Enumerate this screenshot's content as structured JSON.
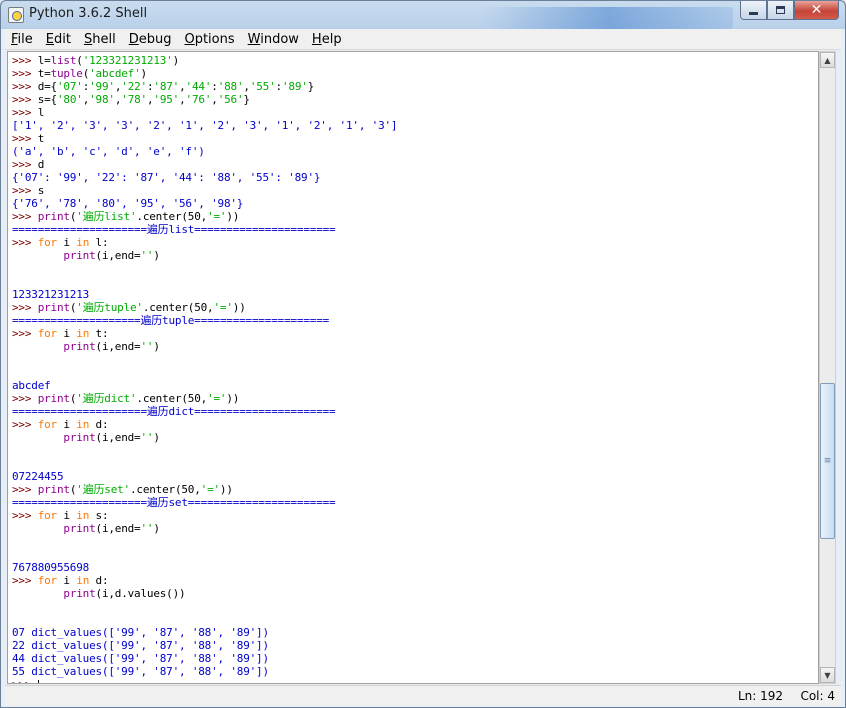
{
  "window": {
    "title": "Python 3.6.2 Shell",
    "controls": {
      "minimize": "minimize",
      "maximize": "maximize",
      "close": "✕"
    }
  },
  "menubar": {
    "items": [
      "File",
      "Edit",
      "Shell",
      "Debug",
      "Options",
      "Window",
      "Help"
    ]
  },
  "colors": {
    "prompt": "#770000",
    "keyword": "#ff7700",
    "builtin": "#900090",
    "string": "#00aa00",
    "stdout": "#0000cc"
  },
  "shell": {
    "lines": [
      [
        [
          "p",
          ">>> "
        ],
        [
          "c",
          "l="
        ],
        [
          "b",
          "list"
        ],
        [
          "c",
          "("
        ],
        [
          "s",
          "'123321231213'"
        ],
        [
          "c",
          ")"
        ]
      ],
      [
        [
          "p",
          ">>> "
        ],
        [
          "c",
          "t="
        ],
        [
          "b",
          "tuple"
        ],
        [
          "c",
          "("
        ],
        [
          "s",
          "'abcdef'"
        ],
        [
          "c",
          ")"
        ]
      ],
      [
        [
          "p",
          ">>> "
        ],
        [
          "c",
          "d={"
        ],
        [
          "s",
          "'07'"
        ],
        [
          "c",
          ":"
        ],
        [
          "s",
          "'99'"
        ],
        [
          "c",
          ","
        ],
        [
          "s",
          "'22'"
        ],
        [
          "c",
          ":"
        ],
        [
          "s",
          "'87'"
        ],
        [
          "c",
          ","
        ],
        [
          "s",
          "'44'"
        ],
        [
          "c",
          ":"
        ],
        [
          "s",
          "'88'"
        ],
        [
          "c",
          ","
        ],
        [
          "s",
          "'55'"
        ],
        [
          "c",
          ":"
        ],
        [
          "s",
          "'89'"
        ],
        [
          "c",
          "}"
        ]
      ],
      [
        [
          "p",
          ">>> "
        ],
        [
          "c",
          "s={"
        ],
        [
          "s",
          "'80'"
        ],
        [
          "c",
          ","
        ],
        [
          "s",
          "'98'"
        ],
        [
          "c",
          ","
        ],
        [
          "s",
          "'78'"
        ],
        [
          "c",
          ","
        ],
        [
          "s",
          "'95'"
        ],
        [
          "c",
          ","
        ],
        [
          "s",
          "'76'"
        ],
        [
          "c",
          ","
        ],
        [
          "s",
          "'56'"
        ],
        [
          "c",
          "}"
        ]
      ],
      [
        [
          "p",
          ">>> "
        ],
        [
          "c",
          "l"
        ]
      ],
      [
        [
          "o",
          "['1', '2', '3', '3', '2', '1', '2', '3', '1', '2', '1', '3']"
        ]
      ],
      [
        [
          "p",
          ">>> "
        ],
        [
          "c",
          "t"
        ]
      ],
      [
        [
          "o",
          "('a', 'b', 'c', 'd', 'e', 'f')"
        ]
      ],
      [
        [
          "p",
          ">>> "
        ],
        [
          "c",
          "d"
        ]
      ],
      [
        [
          "o",
          "{'07': '99', '22': '87', '44': '88', '55': '89'}"
        ]
      ],
      [
        [
          "p",
          ">>> "
        ],
        [
          "c",
          "s"
        ]
      ],
      [
        [
          "o",
          "{'76', '78', '80', '95', '56', '98'}"
        ]
      ],
      [
        [
          "p",
          ">>> "
        ],
        [
          "b",
          "print"
        ],
        [
          "c",
          "("
        ],
        [
          "s",
          "'遍历list'"
        ],
        [
          "c",
          ".center(50,"
        ],
        [
          "s",
          "'='"
        ],
        [
          "c",
          "))"
        ]
      ],
      [
        [
          "o",
          "=====================遍历list======================"
        ]
      ],
      [
        [
          "p",
          ">>> "
        ],
        [
          "k",
          "for"
        ],
        [
          "c",
          " i "
        ],
        [
          "k",
          "in"
        ],
        [
          "c",
          " l:"
        ]
      ],
      [
        [
          "c",
          "        "
        ],
        [
          "b",
          "print"
        ],
        [
          "c",
          "(i,end="
        ],
        [
          "s",
          "''"
        ],
        [
          "c",
          ")"
        ]
      ],
      [],
      [],
      [
        [
          "o",
          "123321231213"
        ]
      ],
      [
        [
          "p",
          ">>> "
        ],
        [
          "b",
          "print"
        ],
        [
          "c",
          "("
        ],
        [
          "s",
          "'遍历tuple'"
        ],
        [
          "c",
          ".center(50,"
        ],
        [
          "s",
          "'='"
        ],
        [
          "c",
          "))"
        ]
      ],
      [
        [
          "o",
          "====================遍历tuple====================="
        ]
      ],
      [
        [
          "p",
          ">>> "
        ],
        [
          "k",
          "for"
        ],
        [
          "c",
          " i "
        ],
        [
          "k",
          "in"
        ],
        [
          "c",
          " t:"
        ]
      ],
      [
        [
          "c",
          "        "
        ],
        [
          "b",
          "print"
        ],
        [
          "c",
          "(i,end="
        ],
        [
          "s",
          "''"
        ],
        [
          "c",
          ")"
        ]
      ],
      [],
      [],
      [
        [
          "o",
          "abcdef"
        ]
      ],
      [
        [
          "p",
          ">>> "
        ],
        [
          "b",
          "print"
        ],
        [
          "c",
          "("
        ],
        [
          "s",
          "'遍历dict'"
        ],
        [
          "c",
          ".center(50,"
        ],
        [
          "s",
          "'='"
        ],
        [
          "c",
          "))"
        ]
      ],
      [
        [
          "o",
          "=====================遍历dict======================"
        ]
      ],
      [
        [
          "p",
          ">>> "
        ],
        [
          "k",
          "for"
        ],
        [
          "c",
          " i "
        ],
        [
          "k",
          "in"
        ],
        [
          "c",
          " d:"
        ]
      ],
      [
        [
          "c",
          "        "
        ],
        [
          "b",
          "print"
        ],
        [
          "c",
          "(i,end="
        ],
        [
          "s",
          "''"
        ],
        [
          "c",
          ")"
        ]
      ],
      [],
      [],
      [
        [
          "o",
          "07224455"
        ]
      ],
      [
        [
          "p",
          ">>> "
        ],
        [
          "b",
          "print"
        ],
        [
          "c",
          "("
        ],
        [
          "s",
          "'遍历set'"
        ],
        [
          "c",
          ".center(50,"
        ],
        [
          "s",
          "'='"
        ],
        [
          "c",
          "))"
        ]
      ],
      [
        [
          "o",
          "=====================遍历set======================="
        ]
      ],
      [
        [
          "p",
          ">>> "
        ],
        [
          "k",
          "for"
        ],
        [
          "c",
          " i "
        ],
        [
          "k",
          "in"
        ],
        [
          "c",
          " s:"
        ]
      ],
      [
        [
          "c",
          "        "
        ],
        [
          "b",
          "print"
        ],
        [
          "c",
          "(i,end="
        ],
        [
          "s",
          "''"
        ],
        [
          "c",
          ")"
        ]
      ],
      [],
      [],
      [
        [
          "o",
          "767880955698"
        ]
      ],
      [
        [
          "p",
          ">>> "
        ],
        [
          "k",
          "for"
        ],
        [
          "c",
          " i "
        ],
        [
          "k",
          "in"
        ],
        [
          "c",
          " d:"
        ]
      ],
      [
        [
          "c",
          "        "
        ],
        [
          "b",
          "print"
        ],
        [
          "c",
          "(i,d.values())"
        ]
      ],
      [],
      [],
      [
        [
          "o",
          "07 dict_values(['99', '87', '88', '89'])"
        ]
      ],
      [
        [
          "o",
          "22 dict_values(['99', '87', '88', '89'])"
        ]
      ],
      [
        [
          "o",
          "44 dict_values(['99', '87', '88', '89'])"
        ]
      ],
      [
        [
          "o",
          "55 dict_values(['99', '87', '88', '89'])"
        ]
      ],
      [
        [
          "p",
          ">>> "
        ],
        [
          "cursor",
          ""
        ]
      ]
    ]
  },
  "scrollbar": {
    "position_fraction": 0.71,
    "visible_fraction": 0.26,
    "grip": "≡",
    "up": "▲",
    "down": "▼"
  },
  "statusbar": {
    "ln": "Ln: 192",
    "col": "Col: 4"
  }
}
